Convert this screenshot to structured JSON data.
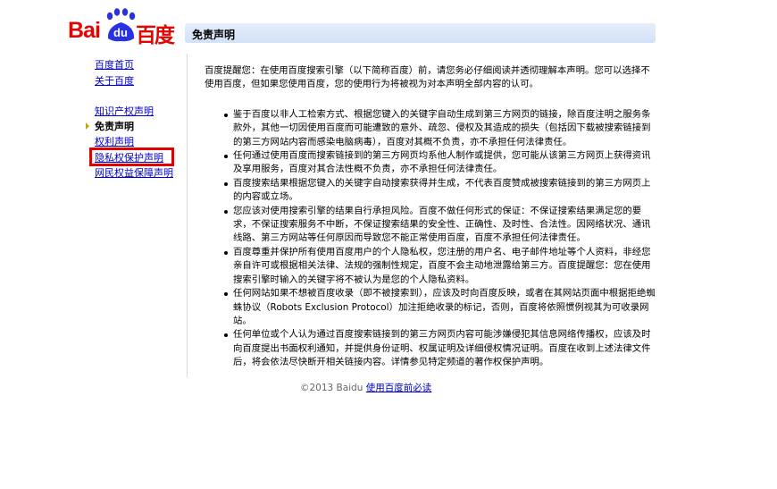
{
  "logo": {
    "brand_latin_1": "Bai",
    "brand_latin_2": "du",
    "brand_cn": "百度",
    "colors": {
      "red": "#e10601",
      "blue": "#2932e1"
    }
  },
  "header": {
    "title": "免责声明"
  },
  "sidebar": {
    "links_top": [
      "百度首页",
      "关于百度"
    ],
    "items": [
      {
        "label": "知识产权声明",
        "current": false
      },
      {
        "label": "免责声明",
        "current": true
      },
      {
        "label": "权利声明",
        "current": false
      },
      {
        "label": "隐私权保护声明",
        "current": false,
        "highlighted": true
      },
      {
        "label": "网民权益保障声明",
        "current": false
      }
    ]
  },
  "content": {
    "intro": "百度提醒您：在使用百度搜索引擎（以下简称百度）前，请您务必仔细阅读并透彻理解本声明。您可以选择不使用百度，但如果您使用百度，您的使用行为将被视为对本声明全部内容的认可。",
    "bullets": [
      "鉴于百度以非人工检索方式、根据您键入的关键字自动生成到第三方网页的链接，除百度注明之服务条款外，其他一切因使用百度而可能遭致的意外、疏忽、侵权及其造成的损失（包括因下载被搜索链接到的第三方网站内容而感染电脑病毒），百度对其概不负责，亦不承担任何法律责任。",
      "任何通过使用百度而搜索链接到的第三方网页均系他人制作或提供，您可能从该第三方网页上获得资讯及享用服务，百度对其合法性概不负责，亦不承担任何法律责任。",
      "百度搜索结果根据您键入的关键字自动搜索获得并生成，不代表百度赞成被搜索链接到的第三方网页上的内容或立场。",
      "您应该对使用搜索引擎的结果自行承担风险。百度不做任何形式的保证：不保证搜索结果满足您的要求，不保证搜索服务不中断，不保证搜索结果的安全性、正确性、及时性、合法性。因网络状况、通讯线路、第三方网站等任何原因而导致您不能正常使用百度，百度不承担任何法律责任。",
      "百度尊重并保护所有使用百度用户的个人隐私权，您注册的用户名、电子邮件地址等个人资料，非经您亲自许可或根据相关法律、法规的强制性规定，百度不会主动地泄露给第三方。百度提醒您：您在使用搜索引擎时输入的关键字将不被认为是您的个人隐私资料。",
      "任何网站如果不想被百度收录（即不被搜索到），应该及时向百度反映，或者在其网站页面中根据拒绝蜘蛛协议（Robots Exclusion Protocol）加注拒绝收录的标记，否则，百度将依照惯例视其为可收录网站。",
      "任何单位或个人认为通过百度搜索链接到的第三方网页内容可能涉嫌侵犯其信息网络传播权，应该及时向百度提出书面权利通知，并提供身份证明、权属证明及详细侵权情况证明。百度在收到上述法律文件后，将会依法尽快断开相关链接内容。详情参见特定频道的著作权保护声明。"
    ]
  },
  "footer": {
    "copyright": "©2013 Baidu",
    "link": "使用百度前必读"
  }
}
